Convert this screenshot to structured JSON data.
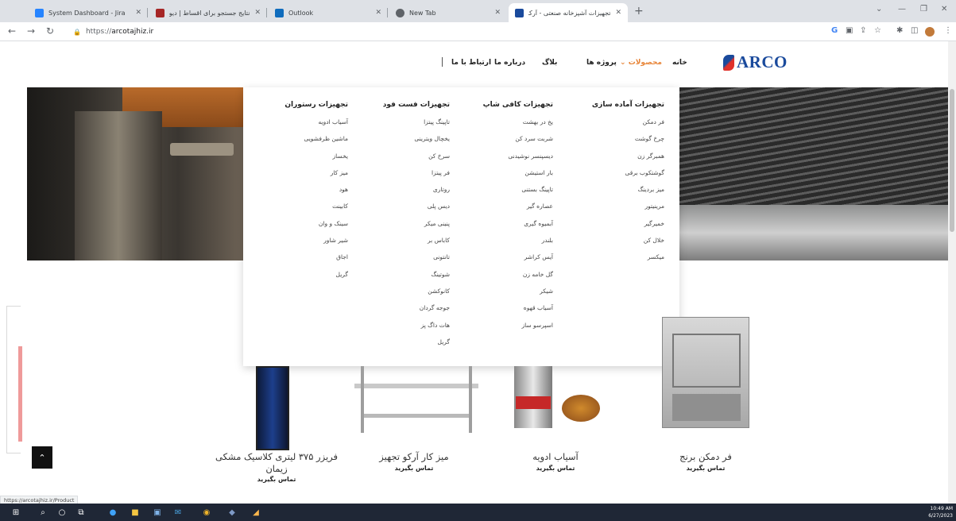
{
  "browser": {
    "tabs": [
      {
        "title": "System Dashboard - Jira",
        "favicon_color": "#2684ff",
        "active": false
      },
      {
        "title": "نتایج جستجو برای اقساط | دیوار",
        "favicon_color": "#a62626",
        "active": false
      },
      {
        "title": "Outlook",
        "favicon_color": "#0f6cbd",
        "active": false
      },
      {
        "title": "New Tab",
        "favicon_color": "#5f6368",
        "active": false
      },
      {
        "title": "تجهیزات آشپزخانه صنعتی - آرکو ت...",
        "favicon_color": "#1a4a9c",
        "active": true
      }
    ],
    "new_tab_symbol": "+",
    "url_scheme": "https://",
    "url_host": "arcotajhiz.ir",
    "status_url": "https://arcotajhiz.ir/Product"
  },
  "site": {
    "logo_text": "ARCO",
    "nav": {
      "home": "خانه",
      "products": "محصولات",
      "projects": "پروژه ها",
      "blog": "بلاگ",
      "about": "درباره ما",
      "contact": "ارتباط با ما"
    },
    "accent_color": "#e8863a",
    "mega_menu": [
      {
        "title": "تجهیزات آماده سازی",
        "items": [
          "فر دمکن",
          "چرخ گوشت",
          "همبرگر زن",
          "گوشتکوب برقی",
          "میز بردینگ",
          "مرینیتور",
          "خمیرگیر",
          "خلال کن",
          "میکسر"
        ]
      },
      {
        "title": "تجهیزات کافی شاپ",
        "items": [
          "یخ در بهشت",
          "شربت سرد کن",
          "دیسپنسر نوشیدنی",
          "بار استیشن",
          "تاپینگ بستنی",
          "عصاره گیر",
          "آبمیوه گیری",
          "بلندر",
          "آیس کراشر",
          "گل خامه زن",
          "شیکر",
          "آسیاب قهوه",
          "اسپرسو ساز"
        ]
      },
      {
        "title": "تجهیزات فست فود",
        "items": [
          "تاپینگ پیتزا",
          "یخچال ویترینی",
          "سرخ کن",
          "فر پیتزا",
          "روتاری",
          "دیس پلی",
          "پنینی میکر",
          "کاباس بر",
          "تانتونی",
          "شوتینگ",
          "کانوکشن",
          "جوجه گردان",
          "هات داگ پز",
          "گریل"
        ]
      },
      {
        "title": "تجهیزات رستوران",
        "items": [
          "آسیاب ادویه",
          "ماشین ظرفشویی",
          "یخساز",
          "میز کار",
          "هود",
          "کابینت",
          "سینک و وان",
          "شیر شاور",
          "اجاق",
          "گریل"
        ]
      }
    ],
    "products": [
      {
        "name": "فر دمکن برنج",
        "cta": "تماس بگیرید"
      },
      {
        "name": "آسیاب ادویه",
        "cta": "تماس بگیرید"
      },
      {
        "name": "میز کار آرکو تجهیز",
        "cta": "تماس بگیرید"
      },
      {
        "name_line1": "فریزر ۳۷۵ لیتری کلاسیک مشکی",
        "name_line2": "زیمان",
        "cta": "تماس بگیرید"
      }
    ]
  },
  "taskbar": {
    "time": "10:49 AM",
    "date": "6/27/2023"
  }
}
